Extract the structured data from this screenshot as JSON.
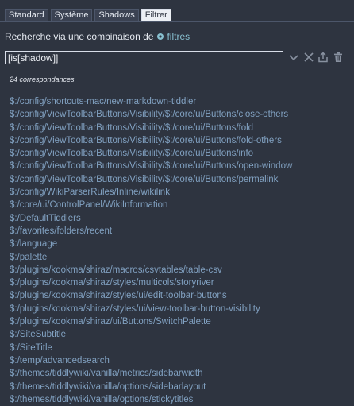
{
  "tabs": [
    {
      "label": "Standard"
    },
    {
      "label": "Système"
    },
    {
      "label": "Shadows"
    },
    {
      "label": "Filtrer",
      "active": true
    }
  ],
  "search": {
    "caption": "Recherche via une combinaison de",
    "filters_link": "filtres",
    "value": "[is[shadow]]"
  },
  "toolbar": {
    "icons": [
      "chevron-down-icon",
      "close-icon",
      "export-icon",
      "trash-icon"
    ]
  },
  "result_count": "24 correspondances",
  "results": [
    "$:/config/shortcuts-mac/new-markdown-tiddler",
    "$:/config/ViewToolbarButtons/Visibility/$:/core/ui/Buttons/close-others",
    "$:/config/ViewToolbarButtons/Visibility/$:/core/ui/Buttons/fold",
    "$:/config/ViewToolbarButtons/Visibility/$:/core/ui/Buttons/fold-others",
    "$:/config/ViewToolbarButtons/Visibility/$:/core/ui/Buttons/info",
    "$:/config/ViewToolbarButtons/Visibility/$:/core/ui/Buttons/open-window",
    "$:/config/ViewToolbarButtons/Visibility/$:/core/ui/Buttons/permalink",
    "$:/config/WikiParserRules/Inline/wikilink",
    "$:/core/ui/ControlPanel/WikiInformation",
    "$:/DefaultTiddlers",
    "$:/favorites/folders/recent",
    "$:/language",
    "$:/palette",
    "$:/plugins/kookma/shiraz/macros/csvtables/table-csv",
    "$:/plugins/kookma/shiraz/styles/multicols/storyriver",
    "$:/plugins/kookma/shiraz/styles/ui/edit-toolbar-buttons",
    "$:/plugins/kookma/shiraz/styles/ui/view-toolbar-button-visibility",
    "$:/plugins/kookma/shiraz/ui/Buttons/SwitchPalette",
    "$:/SiteSubtitle",
    "$:/SiteTitle",
    "$:/temp/advancedsearch",
    "$:/themes/tiddlywiki/vanilla/metrics/sidebarwidth",
    "$:/themes/tiddlywiki/vanilla/options/sidebarlayout",
    "$:/themes/tiddlywiki/vanilla/options/stickytitles"
  ],
  "colors": {
    "background": "#2e3440",
    "link": "#81a1c1",
    "accent": "#88c0d0",
    "icon": "#8891a0"
  }
}
